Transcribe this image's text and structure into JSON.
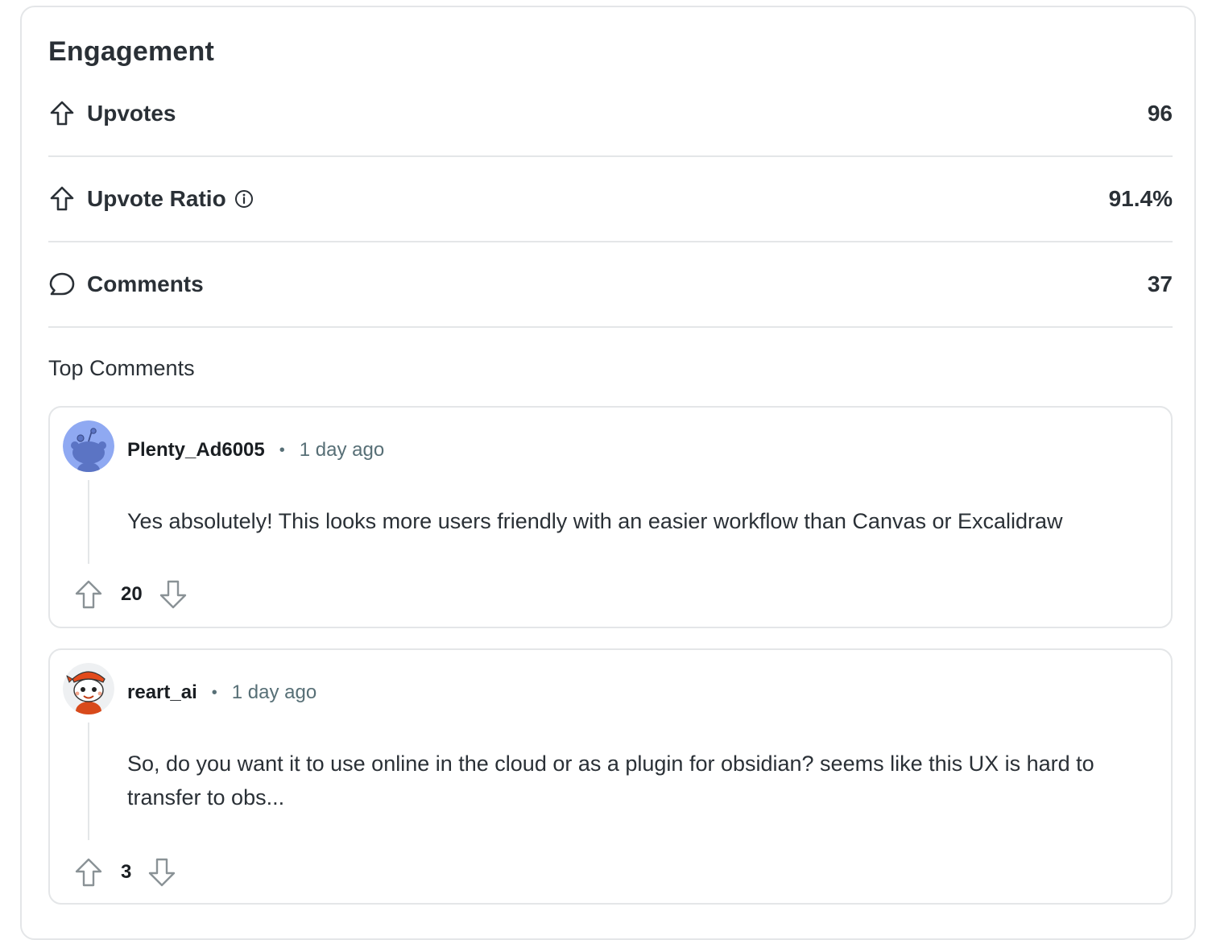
{
  "engagement": {
    "title": "Engagement",
    "stats": [
      {
        "label": "Upvotes",
        "value": "96",
        "icon": "arrow-up-outline-icon"
      },
      {
        "label": "Upvote Ratio",
        "value": "91.4%",
        "icon": "arrow-up-outline-icon",
        "has_info": true
      },
      {
        "label": "Comments",
        "value": "37",
        "icon": "comment-bubble-icon"
      }
    ]
  },
  "top_comments": {
    "title": "Top Comments",
    "comments": [
      {
        "author": "Plenty_Ad6005",
        "separator": "•",
        "time": "1 day ago",
        "body": "Yes absolutely! This looks more users friendly with an easier workflow than Canvas or Excalidraw",
        "score": "20",
        "avatar": "default-snoo-avatar-icon",
        "avatar_color": "#8fa9f2"
      },
      {
        "author": "reart_ai",
        "separator": "•",
        "time": "1 day ago",
        "body": "So, do you want it to use online in the cloud or as a plugin for obsidian? seems like this UX is hard to transfer to obs...",
        "score": "3",
        "avatar": "custom-snoo-avatar-icon",
        "avatar_color": "#d84a1b"
      }
    ]
  },
  "colors": {
    "border": "#e4e6e8",
    "text_primary": "#2a3036",
    "text_secondary": "#576f76",
    "icon_stroke": "#2a3036",
    "vote_stroke": "#8a9296"
  }
}
